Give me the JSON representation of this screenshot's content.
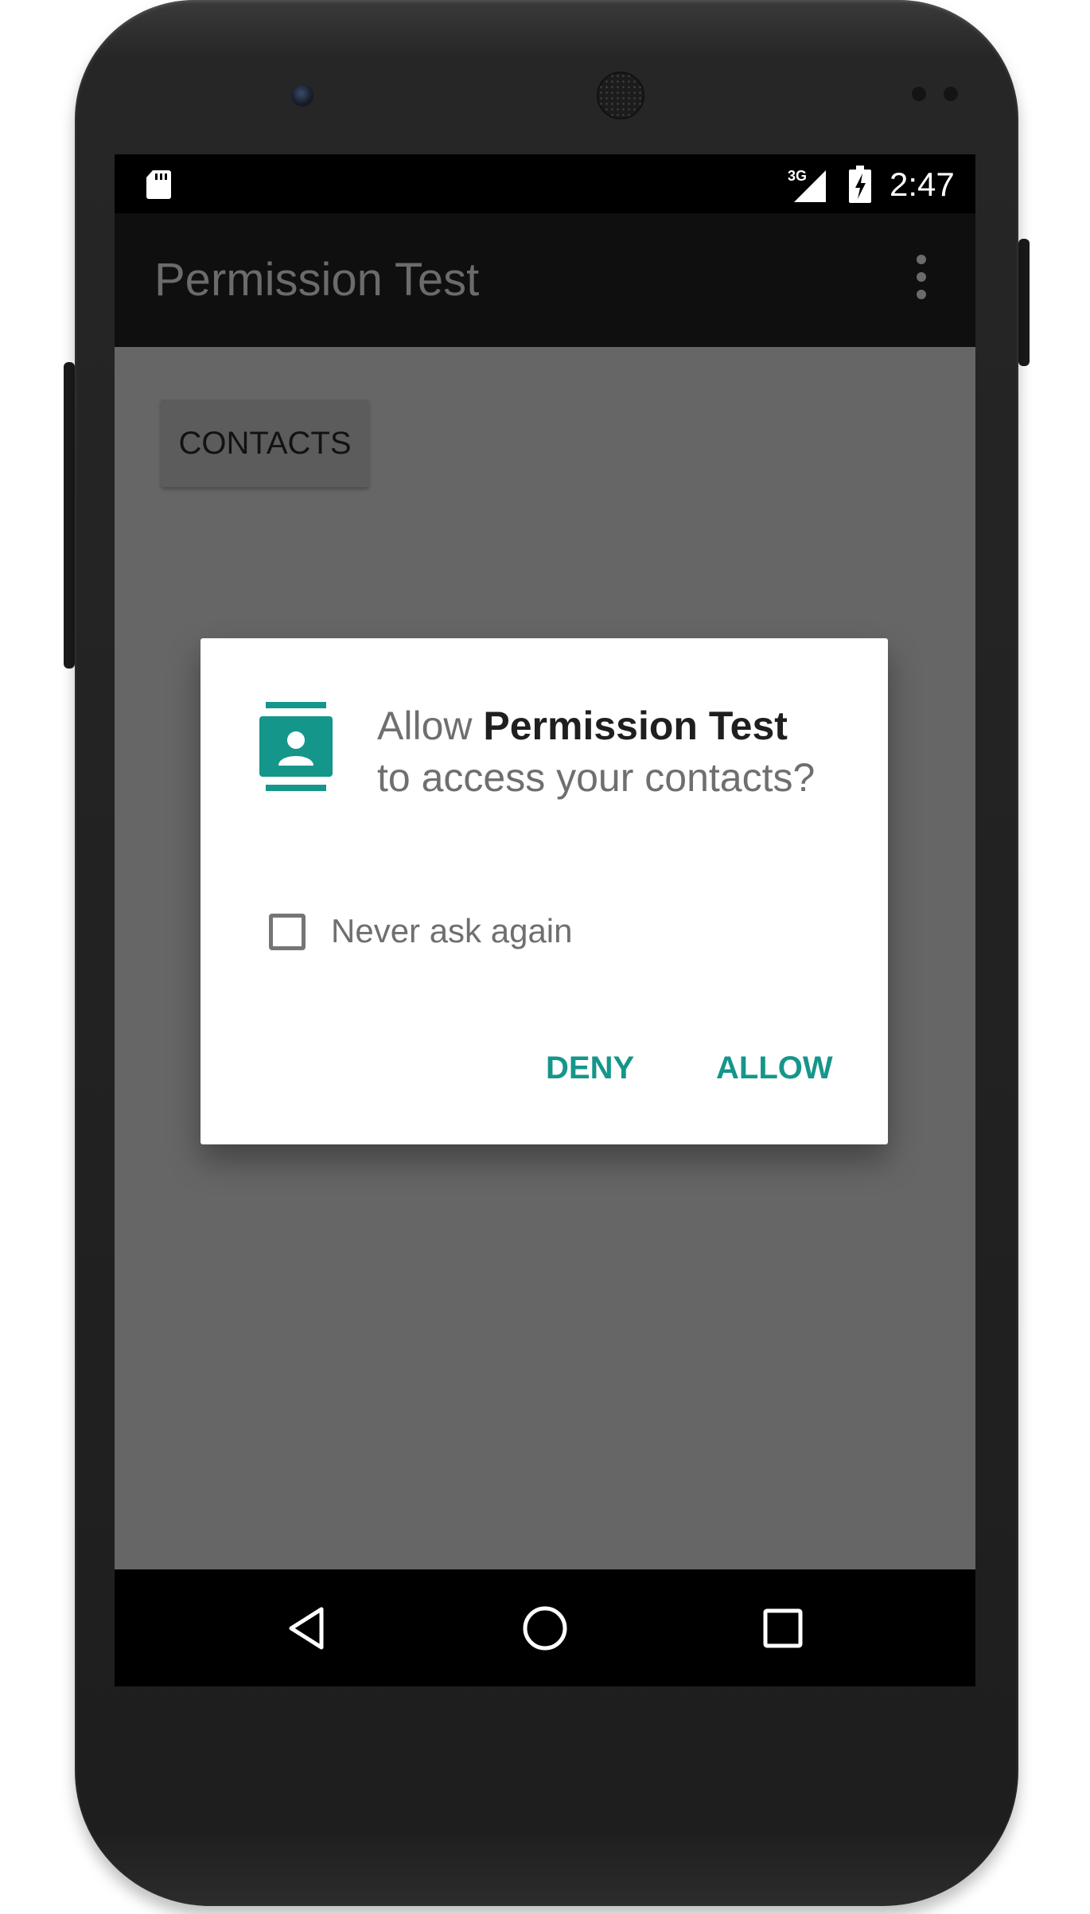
{
  "status_bar": {
    "network": "3G",
    "time": "2:47",
    "icons": [
      "sd-card-icon",
      "signal-icon",
      "battery-charging-icon"
    ]
  },
  "app_bar": {
    "title": "Permission Test",
    "menu_icon": "overflow-menu-icon"
  },
  "main": {
    "contacts_button_label": "CONTACTS"
  },
  "dialog": {
    "icon": "contacts-icon",
    "message_prefix": "Allow ",
    "app_name": "Permission Test",
    "message_suffix": " to access your contacts?",
    "checkbox_label": "Never ask again",
    "checkbox_checked": false,
    "deny_label": "DENY",
    "allow_label": "ALLOW",
    "accent_color": "#15968a"
  },
  "nav_bar": {
    "icons": [
      "back-icon",
      "home-icon",
      "recents-icon"
    ]
  }
}
